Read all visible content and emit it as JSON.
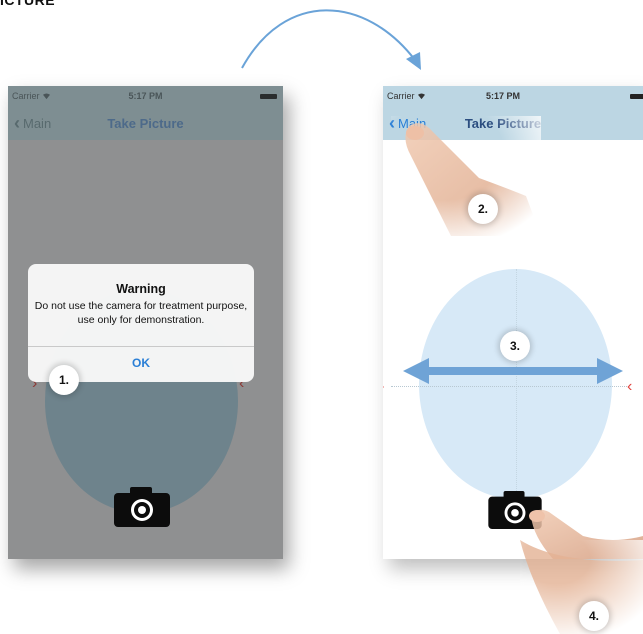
{
  "heading": "ICTURE",
  "statusbar": {
    "carrier": "Carrier",
    "time": "5:17 PM"
  },
  "navbar": {
    "back_label": "Main",
    "title": "Take Picture"
  },
  "alert": {
    "title": "Warning",
    "message": "Do not use the camera for treatment purpose, use only for demonstration.",
    "ok_label": "OK"
  },
  "callouts": [
    "1.",
    "2.",
    "3.",
    "4."
  ],
  "icons": {
    "wifi": "wifi-icon",
    "battery": "battery-icon",
    "back": "chevron-left-icon",
    "camera": "camera-icon",
    "arrow": "curved-arrow-icon"
  },
  "colors": {
    "accent_blue": "#2a7fd6",
    "arrow_blue": "#5b9bd5",
    "guide_red": "#e0443f",
    "oval_fill": "#d7e9f7",
    "navbar_bg": "#bcd6e3"
  }
}
